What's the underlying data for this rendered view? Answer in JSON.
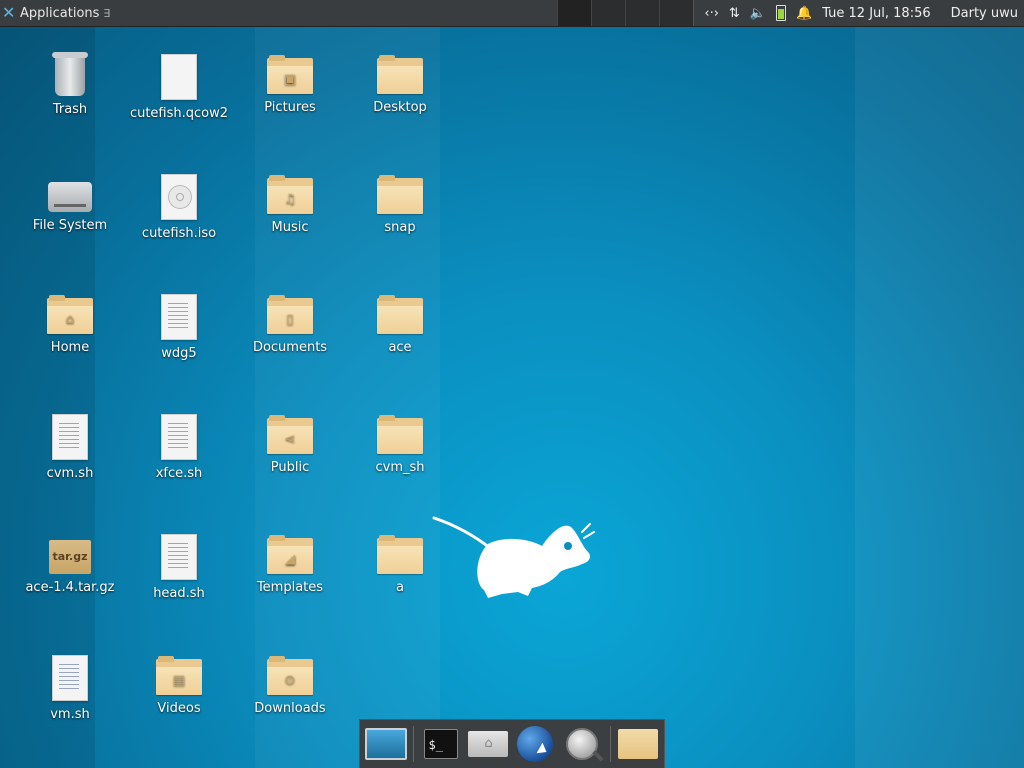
{
  "panel": {
    "applications_label": "Applications",
    "applications_sep": "∃",
    "clock": "Tue 12 Jul, 18:56",
    "user": "Darty uwu"
  },
  "desktop_icons": [
    {
      "label": "Trash",
      "icon": "trash-icon"
    },
    {
      "label": "cutefish.qcow2",
      "icon": "file-icon"
    },
    {
      "label": "Pictures",
      "icon": "folder-pictures-icon"
    },
    {
      "label": "Desktop",
      "icon": "folder-icon"
    },
    {
      "label": "File System",
      "icon": "hard-drive-icon"
    },
    {
      "label": "cutefish.iso",
      "icon": "disc-image-icon"
    },
    {
      "label": "Music",
      "icon": "folder-music-icon"
    },
    {
      "label": "snap",
      "icon": "folder-icon"
    },
    {
      "label": "Home",
      "icon": "folder-home-icon"
    },
    {
      "label": "wdg5",
      "icon": "text-file-icon"
    },
    {
      "label": "Documents",
      "icon": "folder-documents-icon"
    },
    {
      "label": "ace",
      "icon": "folder-icon"
    },
    {
      "label": "cvm.sh",
      "icon": "text-file-icon"
    },
    {
      "label": "xfce.sh",
      "icon": "text-file-icon"
    },
    {
      "label": "Public",
      "icon": "folder-public-icon"
    },
    {
      "label": "cvm_sh",
      "icon": "folder-icon"
    },
    {
      "label": "ace-1.4.tar.gz",
      "icon": "archive-icon"
    },
    {
      "label": "head.sh",
      "icon": "text-file-icon"
    },
    {
      "label": "Templates",
      "icon": "folder-templates-icon"
    },
    {
      "label": "a",
      "icon": "folder-icon"
    },
    {
      "label": "vm.sh",
      "icon": "text-file-icon"
    },
    {
      "label": "Videos",
      "icon": "folder-videos-icon"
    },
    {
      "label": "Downloads",
      "icon": "folder-downloads-icon"
    }
  ],
  "archive_badge": "tar.gz",
  "terminal_prompt": "$_",
  "dock": [
    "show-desktop-icon",
    "terminal-icon",
    "file-manager-icon",
    "web-browser-icon",
    "app-finder-icon",
    "folder-icon"
  ]
}
